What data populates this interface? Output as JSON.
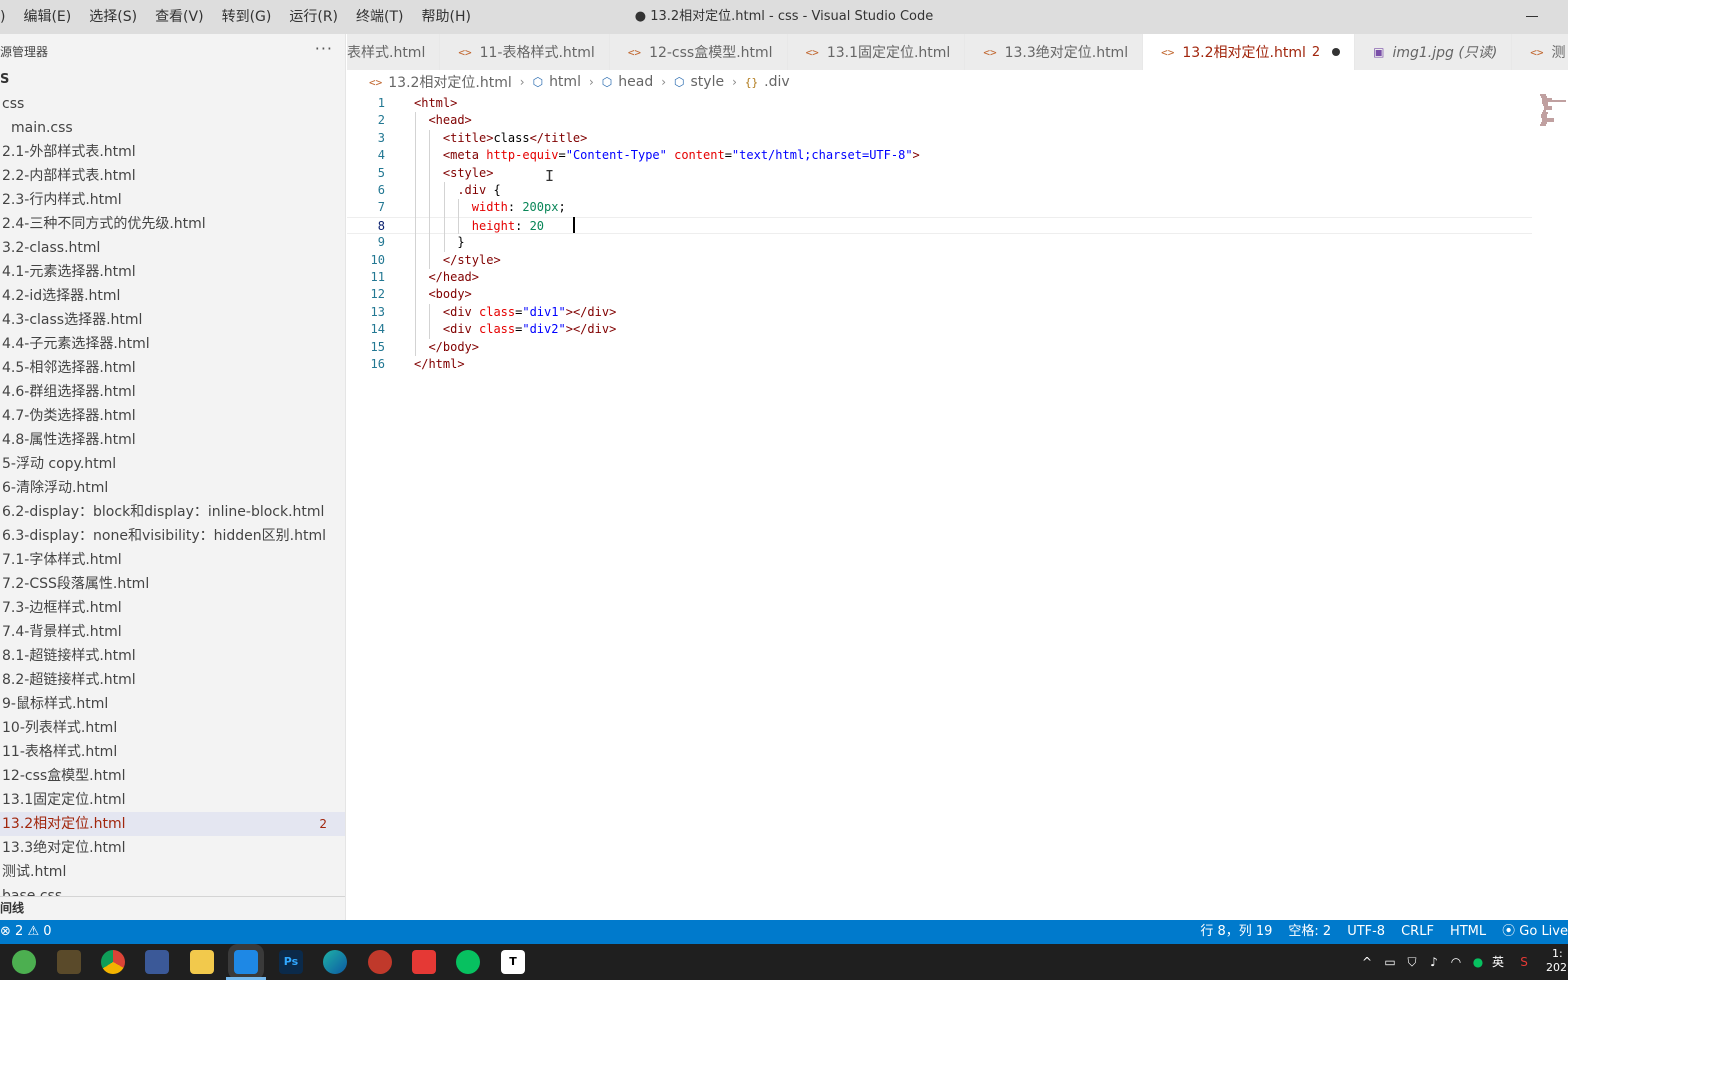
{
  "menu": [
    "编辑(E)",
    "选择(S)",
    "查看(V)",
    "转到(G)",
    "运行(R)",
    "终端(T)",
    "帮助(H)"
  ],
  "menu_partial_first": ")",
  "window_title": "● 13.2相对定位.html - css - Visual Studio Code",
  "sidebar": {
    "title": "源管理器",
    "more": "···",
    "folder": "S",
    "items": [
      {
        "label": "css",
        "indent": 1
      },
      {
        "label": "main.css",
        "indent": 2
      },
      {
        "label": "2.1-外部样式表.html",
        "indent": 1
      },
      {
        "label": "2.2-内部样式表.html",
        "indent": 1
      },
      {
        "label": "2.3-行内样式.html",
        "indent": 1
      },
      {
        "label": "2.4-三种不同方式的优先级.html",
        "indent": 1
      },
      {
        "label": "3.2-class.html",
        "indent": 1
      },
      {
        "label": "4.1-元素选择器.html",
        "indent": 1
      },
      {
        "label": "4.2-id选择器.html",
        "indent": 1
      },
      {
        "label": "4.3-class选择器.html",
        "indent": 1
      },
      {
        "label": "4.4-子元素选择器.html",
        "indent": 1
      },
      {
        "label": "4.5-相邻选择器.html",
        "indent": 1
      },
      {
        "label": "4.6-群组选择器.html",
        "indent": 1
      },
      {
        "label": "4.7-伪类选择器.html",
        "indent": 1
      },
      {
        "label": "4.8-属性选择器.html",
        "indent": 1
      },
      {
        "label": "5-浮动 copy.html",
        "indent": 1
      },
      {
        "label": "6-清除浮动.html",
        "indent": 1
      },
      {
        "label": "6.2-display：block和display：inline-block.html",
        "indent": 1
      },
      {
        "label": "6.3-display：none和visibility：hidden区别.html",
        "indent": 1
      },
      {
        "label": "7.1-字体样式.html",
        "indent": 1
      },
      {
        "label": "7.2-CSS段落属性.html",
        "indent": 1
      },
      {
        "label": "7.3-边框样式.html",
        "indent": 1
      },
      {
        "label": "7.4-背景样式.html",
        "indent": 1
      },
      {
        "label": "8.1-超链接样式.html",
        "indent": 1
      },
      {
        "label": "8.2-超链接样式.html",
        "indent": 1
      },
      {
        "label": "9-鼠标样式.html",
        "indent": 1
      },
      {
        "label": "10-列表样式.html",
        "indent": 1
      },
      {
        "label": "11-表格样式.html",
        "indent": 1
      },
      {
        "label": "12-css盒模型.html",
        "indent": 1
      },
      {
        "label": "13.1固定定位.html",
        "indent": 1
      },
      {
        "label": "13.2相对定位.html",
        "indent": 1,
        "active": true,
        "badge": "2"
      },
      {
        "label": "13.3绝对定位.html",
        "indent": 1
      },
      {
        "label": "测试.html",
        "indent": 1
      },
      {
        "label": "base.css",
        "indent": 1
      }
    ],
    "footer": "间线"
  },
  "tabs": [
    {
      "label": "表样式.html",
      "icon": "html-file-icon"
    },
    {
      "label": "11-表格样式.html",
      "icon": "html-file-icon"
    },
    {
      "label": "12-css盒模型.html",
      "icon": "html-file-icon"
    },
    {
      "label": "13.1固定定位.html",
      "icon": "html-file-icon"
    },
    {
      "label": "13.3绝对定位.html",
      "icon": "html-file-icon"
    },
    {
      "label": "13.2相对定位.html",
      "icon": "html-file-icon",
      "active": true,
      "badge": "2",
      "dirty": true
    },
    {
      "label": "img1.jpg (只读)",
      "icon": "image-file-icon",
      "italic": true
    },
    {
      "label": "测",
      "icon": "html-file-icon"
    }
  ],
  "breadcrumb": [
    "13.2相对定位.html",
    "html",
    "head",
    "style",
    ".div"
  ],
  "code_lines": [
    {
      "n": "1",
      "indent": 0,
      "tokens": [
        [
          "tag",
          "<html>"
        ]
      ]
    },
    {
      "n": "2",
      "indent": 1,
      "tokens": [
        [
          "tag",
          "<head>"
        ]
      ]
    },
    {
      "n": "3",
      "indent": 2,
      "tokens": [
        [
          "tag",
          "<title>"
        ],
        [
          "text",
          "class"
        ],
        [
          "tag",
          "</title>"
        ]
      ]
    },
    {
      "n": "4",
      "indent": 2,
      "tokens": [
        [
          "tag",
          "<meta "
        ],
        [
          "attr",
          "http-equiv"
        ],
        [
          "text",
          "="
        ],
        [
          "str",
          "\"Content-Type\""
        ],
        [
          "text",
          " "
        ],
        [
          "attr",
          "content"
        ],
        [
          "text",
          "="
        ],
        [
          "str",
          "\"text/html;charset=UTF-8\""
        ],
        [
          "tag",
          ">"
        ]
      ]
    },
    {
      "n": "5",
      "indent": 2,
      "tokens": [
        [
          "tag",
          "<style>"
        ]
      ]
    },
    {
      "n": "6",
      "indent": 3,
      "tokens": [
        [
          "sel",
          ".div"
        ],
        [
          "punc",
          " {"
        ]
      ]
    },
    {
      "n": "7",
      "indent": 4,
      "tokens": [
        [
          "prop",
          "width"
        ],
        [
          "punc",
          ": "
        ],
        [
          "num",
          "200px"
        ],
        [
          "punc",
          ";"
        ]
      ]
    },
    {
      "n": "8",
      "indent": 4,
      "tokens": [
        [
          "prop",
          "height"
        ],
        [
          "punc",
          ": "
        ],
        [
          "num",
          "20"
        ]
      ],
      "current": true
    },
    {
      "n": "9",
      "indent": 3,
      "tokens": [
        [
          "punc",
          "}"
        ]
      ]
    },
    {
      "n": "10",
      "indent": 2,
      "tokens": [
        [
          "tag",
          "</style>"
        ]
      ]
    },
    {
      "n": "11",
      "indent": 1,
      "tokens": [
        [
          "tag",
          "</head>"
        ]
      ]
    },
    {
      "n": "12",
      "indent": 1,
      "tokens": [
        [
          "tag",
          "<body>"
        ]
      ]
    },
    {
      "n": "13",
      "indent": 2,
      "tokens": [
        [
          "tag",
          "<div "
        ],
        [
          "attr",
          "class"
        ],
        [
          "text",
          "="
        ],
        [
          "str",
          "\"div1\""
        ],
        [
          "tag",
          "></div>"
        ]
      ]
    },
    {
      "n": "14",
      "indent": 2,
      "tokens": [
        [
          "tag",
          "<div "
        ],
        [
          "attr",
          "class"
        ],
        [
          "text",
          "="
        ],
        [
          "str",
          "\"div2\""
        ],
        [
          "tag",
          "></div>"
        ]
      ]
    },
    {
      "n": "15",
      "indent": 1,
      "tokens": [
        [
          "tag",
          "</body>"
        ]
      ]
    },
    {
      "n": "16",
      "indent": 0,
      "tokens": [
        [
          "tag",
          "</html>"
        ]
      ]
    }
  ],
  "status": {
    "errors": "2",
    "warnings": "0",
    "position": "行 8，列 19",
    "spaces": "空格: 2",
    "encoding": "UTF-8",
    "eol": "CRLF",
    "language": "HTML",
    "golive": "Go Live"
  },
  "taskbar": {
    "apps": [
      "wechat-style-green-icon",
      "box-icon",
      "chrome-icon",
      "calculator-icon",
      "file-explorer-icon",
      "vscode-icon",
      "photoshop-icon",
      "edge-icon",
      "pycharm-like-icon",
      "app-red-icon",
      "wechat-icon",
      "typora-icon"
    ],
    "ps_label": "Ps",
    "typora_label": "T",
    "ime": "英",
    "clock_partial": "1:",
    "date_partial": "202"
  },
  "colors": {
    "statusbar": "#007acc",
    "active_tab_text": "#a1260d",
    "titlebar": "#dddddd"
  }
}
